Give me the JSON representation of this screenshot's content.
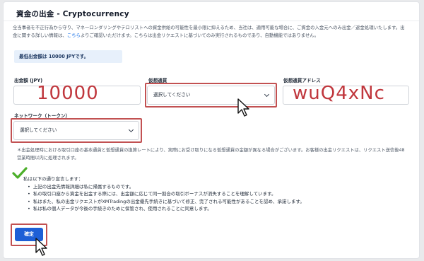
{
  "page": {
    "title": "資金の出金 - Cryptocurrency",
    "description_1": "全当事者を不正行為から守り、マネーロンダリングやテロリストへの資金供給の可能性を最小限に抑えるため、当社は、適用可能な場合に、ご資金の入金元へのみ出金／返金処理いたします。出金に関する詳しい情報は、",
    "description_link": "こちら",
    "description_2": "よりご確認いただけます。こちらは出金リクエストに基づいてのみ実行されるものであり、自動機能ではありません。",
    "min_notice": "最低出金額は 10000 JPYです。"
  },
  "form": {
    "amount_label": "出金額 (JPY)",
    "amount_value": "10000",
    "currency_label": "仮想通貨",
    "currency_selected": "選択してください",
    "address_label": "仮想通貨アドレス",
    "address_value": "wuQ4xNc",
    "network_label": "ネットワーク（トークン）",
    "network_selected": "選択してください"
  },
  "note": "＊出金処理時における取引口座の基本通貨と仮想通貨の換算レートにより、実際にお受け取りになる仮想通貨の金額が異なる場合がございます。お客様の出金リクエストは、リクエスト送信後48営業時間以内に処理されます。",
  "declaration": {
    "intro": "私は以下の通り宣言します：",
    "items": [
      "上記の出金先情報詳細は私に帰属するものです。",
      "私の取引口座から資金を出金する際には、出金額に応じて同一割合の取引ボーナスが消失することを理解しています。",
      "私はまた、私の出金リクエストがXMTradingの出金優先手続きに基づいて修正、完了される可能性があることを認め、承諾します。",
      "私は私の個人データが今後の手続きのために保管され、使用されることに同意します。"
    ]
  },
  "buttons": {
    "confirm": "確定"
  },
  "colors": {
    "accent": "#1d5fd6",
    "annotation_red": "#c0373d",
    "check_green": "#4caf2a"
  },
  "icons": [
    "check-icon",
    "chevron-down-icon",
    "pointer-cursor-icon"
  ]
}
